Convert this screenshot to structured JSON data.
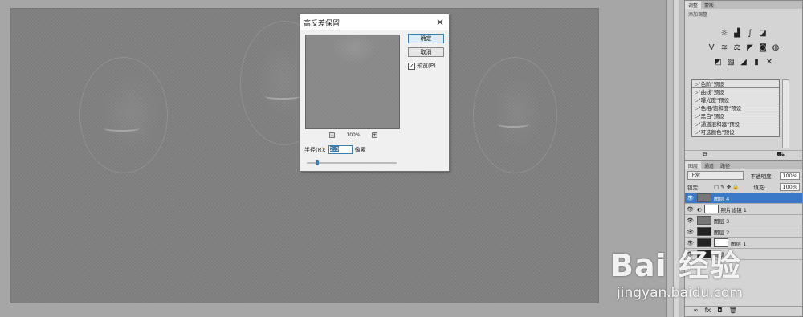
{
  "dialog": {
    "title": "高反差保留",
    "ok_label": "确定",
    "cancel_label": "取消",
    "preview_label": "预览(P)",
    "preview_checked": "✓",
    "zoom": "100%",
    "radius_label": "半径(R):",
    "radius_value": "2.0",
    "radius_unit": "像素",
    "slider_level_fraction": 0.1
  },
  "adjustments": {
    "tabs": [
      "调整",
      "蒙版"
    ],
    "title": "添加调整",
    "presets": [
      "\"色阶\"预设",
      "\"曲线\"预设",
      "\"曝光度\"预设",
      "\"色相/饱和度\"预设",
      "\"黑白\"预设",
      "\"通道混和器\"预设",
      "\"可选颜色\"预设"
    ]
  },
  "layers": {
    "tabs": [
      "图层",
      "通道",
      "路径"
    ],
    "blend_mode": "正常",
    "opacity_label": "不透明度:",
    "opacity_value": "100%",
    "lock_label": "锁定:",
    "fill_label": "填充:",
    "fill_value": "100%",
    "items": [
      {
        "name": "图层 4",
        "selected": true
      },
      {
        "name": "照片滤镜 1",
        "selected": false
      },
      {
        "name": "图层 3",
        "selected": false
      },
      {
        "name": "图层 2",
        "selected": false
      },
      {
        "name": "图层 1",
        "selected": false
      },
      {
        "name": "背景",
        "selected": false
      }
    ]
  },
  "watermark": {
    "logo": "Bai 经验",
    "url": "jingyan.baidu.com"
  }
}
